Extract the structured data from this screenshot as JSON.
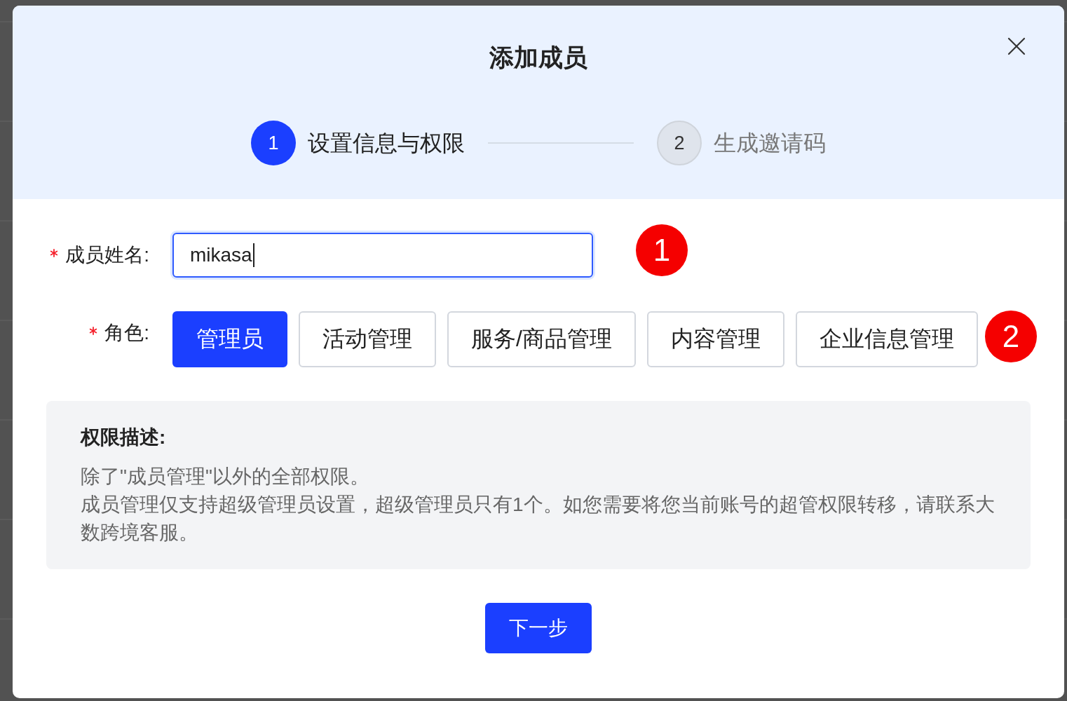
{
  "dialog": {
    "title": "添加成员"
  },
  "steps": [
    {
      "number": "1",
      "label": "设置信息与权限",
      "active": true
    },
    {
      "number": "2",
      "label": "生成邀请码",
      "active": false
    }
  ],
  "form": {
    "name_field": {
      "label": "成员姓名:",
      "required": true,
      "value": "mikasa",
      "focused": true,
      "marker": "1"
    },
    "role_field": {
      "label": "角色:",
      "required": true,
      "marker": "2",
      "options": [
        {
          "label": "管理员",
          "selected": true
        },
        {
          "label": "活动管理",
          "selected": false
        },
        {
          "label": "服务/商品管理",
          "selected": false
        },
        {
          "label": "内容管理",
          "selected": false
        },
        {
          "label": "企业信息管理",
          "selected": false
        }
      ]
    }
  },
  "description": {
    "title": "权限描述:",
    "lines": [
      "除了\"成员管理\"以外的全部权限。",
      "成员管理仅支持超级管理员设置，超级管理员只有1个。如您需要将您当前账号的超管权限转移，请联系大数跨境客服。"
    ]
  },
  "next_button": {
    "label": "下一步"
  }
}
